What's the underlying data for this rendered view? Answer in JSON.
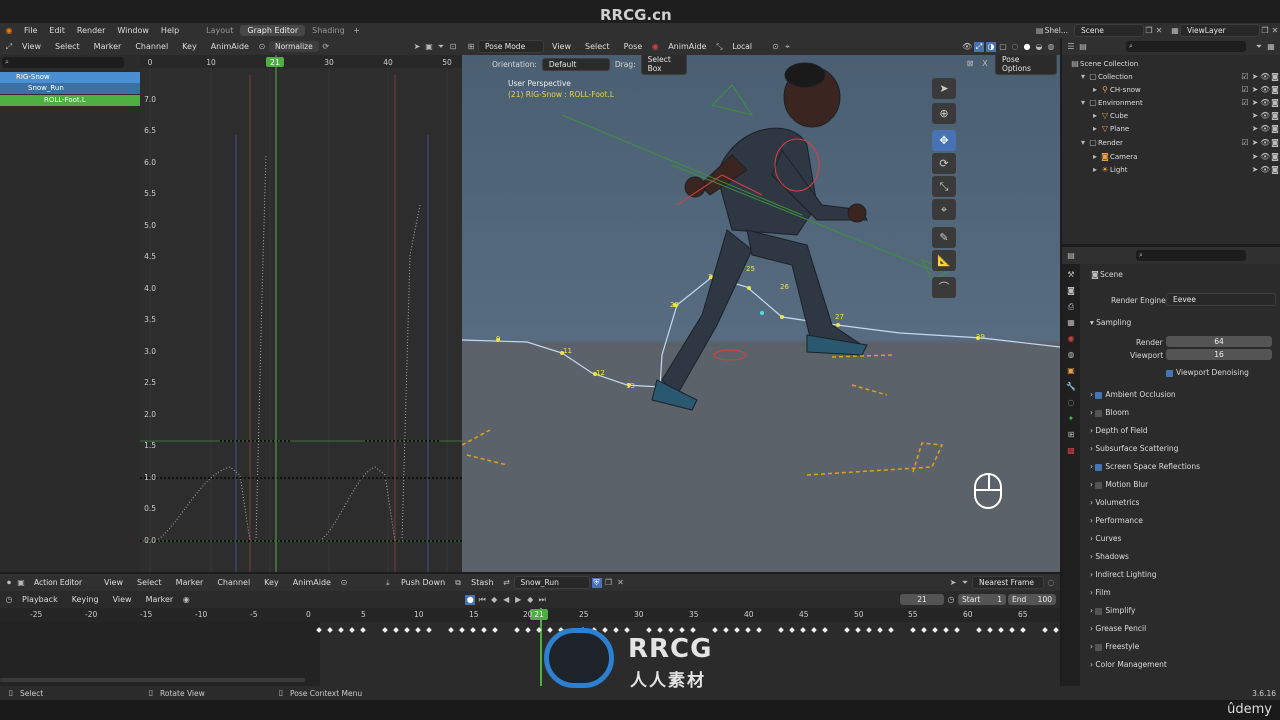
{
  "site_watermark": "RRCG.cn",
  "menu": {
    "items": [
      "File",
      "Edit",
      "Render",
      "Window",
      "Help"
    ]
  },
  "workspaces": {
    "tabs": [
      "Layout",
      "Graph Editor",
      "Shading"
    ],
    "active": "Graph Editor"
  },
  "top_right": {
    "scene_short": "Shel...",
    "scene": "Scene",
    "view_layer": "ViewLayer"
  },
  "graph_editor": {
    "header": {
      "view": "View",
      "select": "Select",
      "marker": "Marker",
      "channel": "Channel",
      "key": "Key",
      "animaide": "AnimAide",
      "normalize": "Normalize"
    },
    "ruler": [
      "0",
      "10",
      "20",
      "30",
      "40",
      "50"
    ],
    "current_frame": "21",
    "y_labels": [
      "7.0",
      "6.5",
      "6.0",
      "5.5",
      "5.0",
      "4.5",
      "4.0",
      "3.5",
      "3.0",
      "2.5",
      "2.0",
      "1.5",
      "1.0",
      "0.5",
      "0.0"
    ],
    "channels": [
      {
        "label": "RIG-Snow",
        "color": "#4a8fd1"
      },
      {
        "label": "Snow_Run",
        "color": "#3c6fa4"
      },
      {
        "label": "ROLL-Foot.L",
        "color": "#4caf3f"
      }
    ]
  },
  "viewport": {
    "header": {
      "mode": "Pose Mode",
      "view": "View",
      "select": "Select",
      "pose": "Pose",
      "animaide": "AnimAide",
      "transform": "Local"
    },
    "orientation_label": "Orientation:",
    "orientation": "Default",
    "drag_label": "Drag:",
    "drag": "Select Box",
    "pose_options": "Pose Options",
    "overlay_title": "User Perspective",
    "overlay_sub": "(21) RIG-Snow : ROLL-Foot.L",
    "path_frames": [
      "9",
      "11",
      "12",
      "13",
      "21",
      "23",
      "24",
      "25",
      "26",
      "27",
      "29"
    ]
  },
  "outliner": {
    "rows": [
      {
        "label": "Scene Collection",
        "indent": 0
      },
      {
        "label": "Collection",
        "indent": 1
      },
      {
        "label": "CH-snow",
        "indent": 2
      },
      {
        "label": "Environment",
        "indent": 1
      },
      {
        "label": "Cube",
        "indent": 2
      },
      {
        "label": "Plane",
        "indent": 2
      },
      {
        "label": "Render",
        "indent": 1
      },
      {
        "label": "Camera",
        "indent": 2
      },
      {
        "label": "Light",
        "indent": 2
      }
    ]
  },
  "properties": {
    "title": "Scene",
    "render_engine_label": "Render Engine",
    "render_engine": "Eevee",
    "sampling": "Sampling",
    "render_label": "Render",
    "render_val": "64",
    "viewport_label": "Viewport",
    "viewport_val": "16",
    "viewport_denoising": "Viewport Denoising",
    "sections": [
      {
        "label": "Ambient Occlusion",
        "check": true
      },
      {
        "label": "Bloom",
        "check": false
      },
      {
        "label": "Depth of Field",
        "check": null
      },
      {
        "label": "Subsurface Scattering",
        "check": null
      },
      {
        "label": "Screen Space Reflections",
        "check": true
      },
      {
        "label": "Motion Blur",
        "check": false
      },
      {
        "label": "Volumetrics",
        "check": null
      },
      {
        "label": "Performance",
        "check": null
      },
      {
        "label": "Curves",
        "check": null
      },
      {
        "label": "Shadows",
        "check": null
      },
      {
        "label": "Indirect Lighting",
        "check": null
      },
      {
        "label": "Film",
        "check": null
      },
      {
        "label": "Simplify",
        "check": false
      },
      {
        "label": "Grease Pencil",
        "check": null
      },
      {
        "label": "Freestyle",
        "check": false
      },
      {
        "label": "Color Management",
        "check": null
      }
    ]
  },
  "action_editor": {
    "mode": "Action Editor",
    "view": "View",
    "select": "Select",
    "marker": "Marker",
    "channel": "Channel",
    "key": "Key",
    "animaide": "AnimAide",
    "push_down": "Push Down",
    "stash": "Stash",
    "action": "Snow_Run",
    "snap": "Nearest Frame"
  },
  "timeline": {
    "playback": "Playback",
    "keying": "Keying",
    "view": "View",
    "marker": "Marker",
    "frame": "21",
    "start_label": "Start",
    "start": "1",
    "end_label": "End",
    "end": "100",
    "ruler": [
      "-25",
      "-20",
      "-15",
      "-10",
      "-5",
      "0",
      "5",
      "10",
      "15",
      "20",
      "21",
      "25",
      "30",
      "35",
      "40",
      "45",
      "50",
      "55",
      "60",
      "65"
    ]
  },
  "statusbar": {
    "select": "Select",
    "rotate": "Rotate View",
    "context": "Pose Context Menu",
    "version": "3.6.16"
  },
  "brand": {
    "udemy": "ûdemy",
    "logo_top": "RRCG",
    "logo_bottom": "人人素材"
  }
}
